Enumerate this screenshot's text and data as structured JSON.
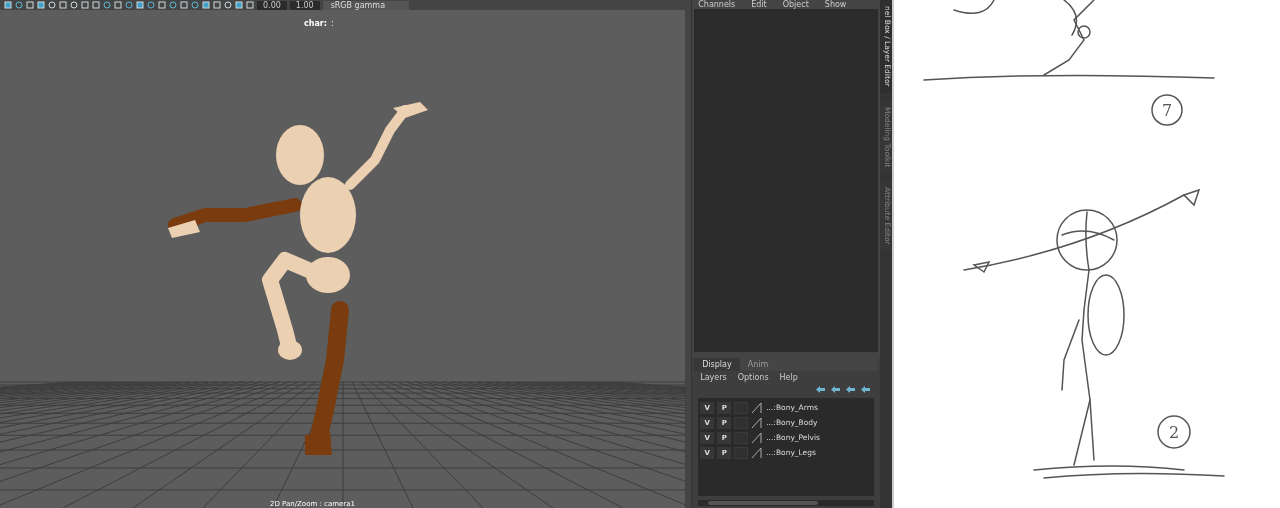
{
  "viewport": {
    "toolbar": {
      "fields": [
        "0.00",
        "1.00"
      ],
      "color_space": "sRGB gamma"
    },
    "hud_label": "char:",
    "hud_separator": ":",
    "camera_label": "2D Pan/Zoom : camera1"
  },
  "channel_box": {
    "menu": [
      "Channels",
      "Edit",
      "Object",
      "Show"
    ]
  },
  "layer_editor": {
    "tabs": [
      {
        "label": "Display",
        "selected": true
      },
      {
        "label": "Anim",
        "selected": false
      }
    ],
    "menu": [
      "Layers",
      "Options",
      "Help"
    ],
    "layers": [
      {
        "visibility": "V",
        "playback": "P",
        "name": "...:Bony_Arms"
      },
      {
        "visibility": "V",
        "playback": "P",
        "name": "...:Bony_Body"
      },
      {
        "visibility": "V",
        "playback": "P",
        "name": "...:Bony_Pelvis"
      },
      {
        "visibility": "V",
        "playback": "P",
        "name": "...:Bony_Legs"
      }
    ]
  },
  "side_tabs": [
    {
      "label": "nel Box / Layer Editor",
      "selected": true
    },
    {
      "label": "Modeling Toolkit",
      "selected": false
    },
    {
      "label": "Attribute Editor",
      "selected": false
    }
  ],
  "sketch": {
    "labels": [
      "7",
      "2"
    ]
  }
}
